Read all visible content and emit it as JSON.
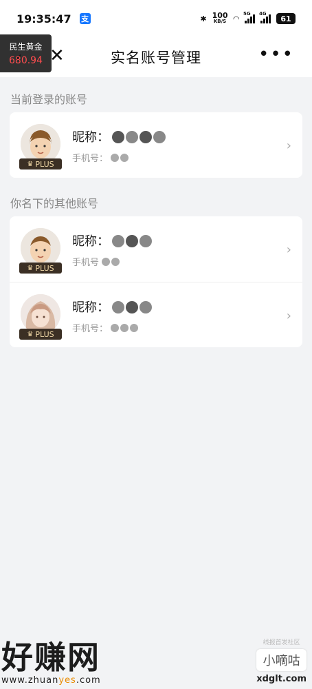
{
  "status_bar": {
    "time": "19:35:47",
    "app_icon": "支",
    "speed_value": "100",
    "speed_unit": "KB/S",
    "sig1_label": "5G",
    "sig2_label": "4G",
    "battery": "61"
  },
  "nav": {
    "back_icon": "‹",
    "close_icon": "✕",
    "title": "实名账号管理",
    "more_icon": "•••"
  },
  "gold_widget": {
    "title": "民生黄金",
    "value": "680.94"
  },
  "sections": {
    "current": "当前登录的账号",
    "others": "你名下的其他账号"
  },
  "accounts": {
    "current": {
      "nickname_label": "昵称：",
      "phone_label": "手机号：",
      "badge": "PLUS"
    },
    "other1": {
      "nickname_label": "昵称：",
      "phone_label": "手机号",
      "badge": "PLUS"
    },
    "other2": {
      "nickname_label": "昵称：",
      "phone_label": "手机号：",
      "badge": "PLUS"
    }
  },
  "chevron": "›",
  "watermark": {
    "left_big": "好赚网",
    "left_small_a": "www.zhuan",
    "left_small_b": "yes",
    "left_small_c": ".com",
    "right_top": "线报首发社区",
    "right_box": "小嘀咕",
    "right_bottom": "xdglt.com"
  },
  "colors": {
    "background": "#f2f3f5",
    "card": "#ffffff",
    "gold_value": "#ff4d4f",
    "badge_bg": "#3b2f24",
    "badge_text": "#f1d9a8"
  }
}
